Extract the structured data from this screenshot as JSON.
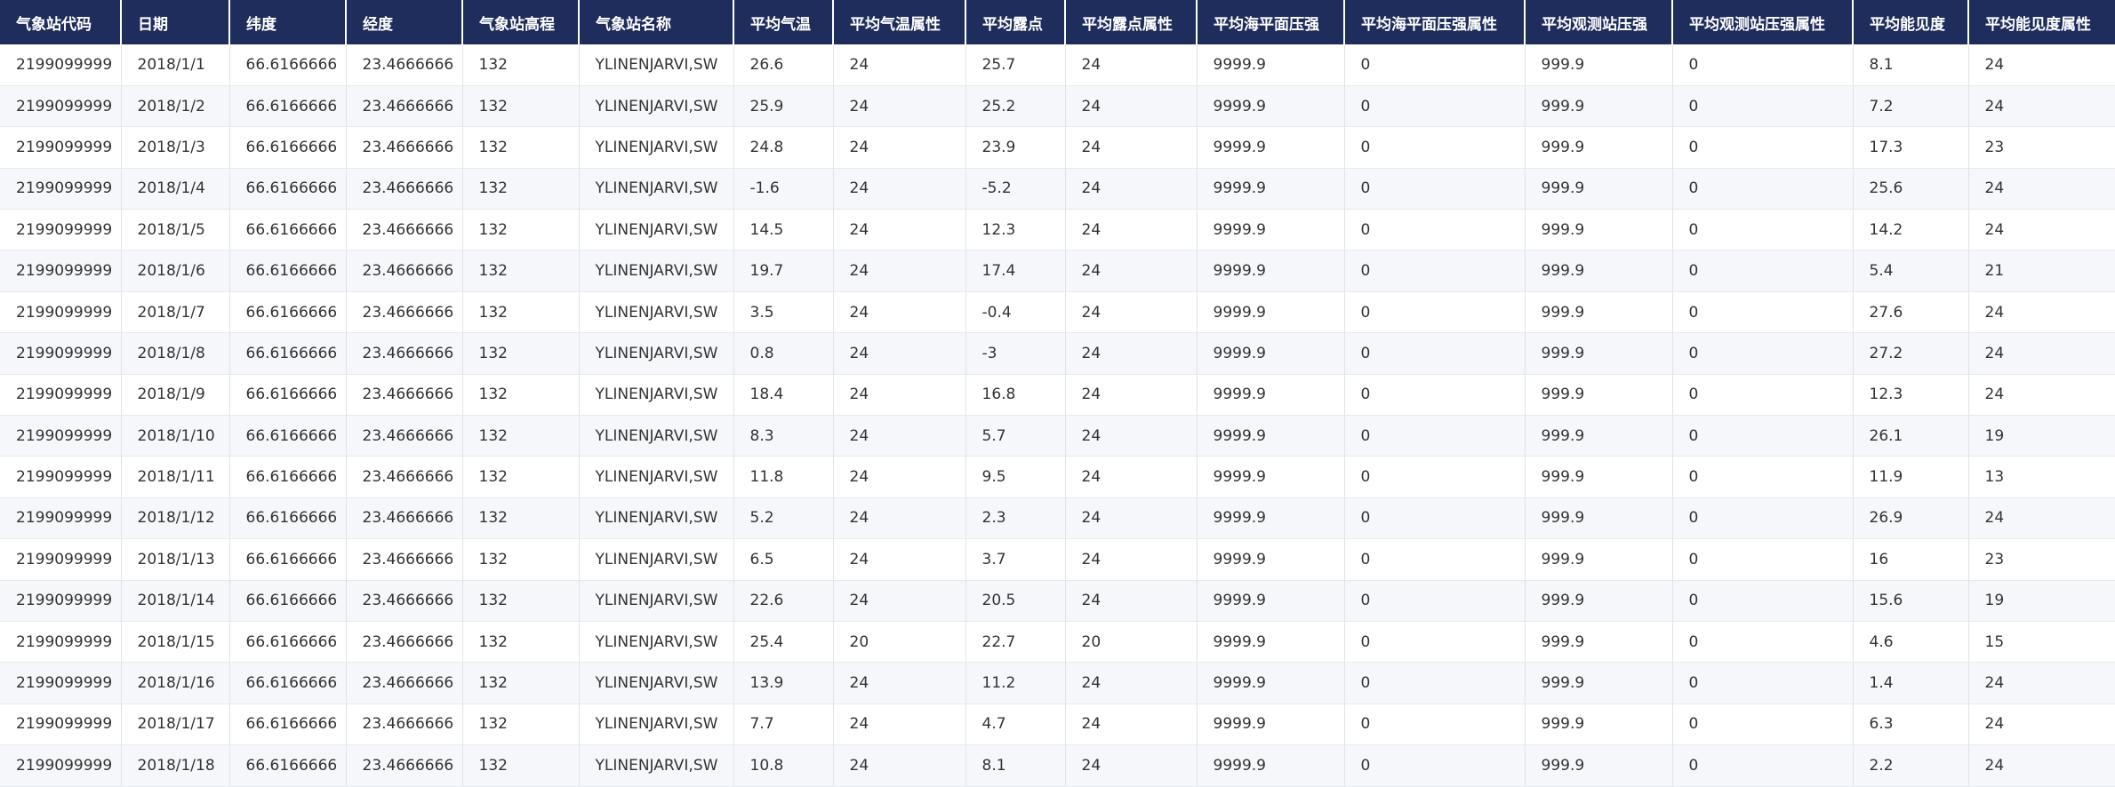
{
  "table": {
    "columns": [
      "气象站代码",
      "日期",
      "纬度",
      "经度",
      "气象站高程",
      "气象站名称",
      "平均气温",
      "平均气温属性",
      "平均露点",
      "平均露点属性",
      "平均海平面压强",
      "平均海平面压强属性",
      "平均观测站压强",
      "平均观测站压强属性",
      "平均能见度",
      "平均能见度属性"
    ],
    "rows": [
      [
        "2199099999",
        "2018/1/1",
        "66.6166666",
        "23.4666666",
        "132",
        "YLINENJARVI,SW",
        "26.6",
        "24",
        "25.7",
        "24",
        "9999.9",
        "0",
        "999.9",
        "0",
        "8.1",
        "24"
      ],
      [
        "2199099999",
        "2018/1/2",
        "66.6166666",
        "23.4666666",
        "132",
        "YLINENJARVI,SW",
        "25.9",
        "24",
        "25.2",
        "24",
        "9999.9",
        "0",
        "999.9",
        "0",
        "7.2",
        "24"
      ],
      [
        "2199099999",
        "2018/1/3",
        "66.6166666",
        "23.4666666",
        "132",
        "YLINENJARVI,SW",
        "24.8",
        "24",
        "23.9",
        "24",
        "9999.9",
        "0",
        "999.9",
        "0",
        "17.3",
        "23"
      ],
      [
        "2199099999",
        "2018/1/4",
        "66.6166666",
        "23.4666666",
        "132",
        "YLINENJARVI,SW",
        "-1.6",
        "24",
        "-5.2",
        "24",
        "9999.9",
        "0",
        "999.9",
        "0",
        "25.6",
        "24"
      ],
      [
        "2199099999",
        "2018/1/5",
        "66.6166666",
        "23.4666666",
        "132",
        "YLINENJARVI,SW",
        "14.5",
        "24",
        "12.3",
        "24",
        "9999.9",
        "0",
        "999.9",
        "0",
        "14.2",
        "24"
      ],
      [
        "2199099999",
        "2018/1/6",
        "66.6166666",
        "23.4666666",
        "132",
        "YLINENJARVI,SW",
        "19.7",
        "24",
        "17.4",
        "24",
        "9999.9",
        "0",
        "999.9",
        "0",
        "5.4",
        "21"
      ],
      [
        "2199099999",
        "2018/1/7",
        "66.6166666",
        "23.4666666",
        "132",
        "YLINENJARVI,SW",
        "3.5",
        "24",
        "-0.4",
        "24",
        "9999.9",
        "0",
        "999.9",
        "0",
        "27.6",
        "24"
      ],
      [
        "2199099999",
        "2018/1/8",
        "66.6166666",
        "23.4666666",
        "132",
        "YLINENJARVI,SW",
        "0.8",
        "24",
        "-3",
        "24",
        "9999.9",
        "0",
        "999.9",
        "0",
        "27.2",
        "24"
      ],
      [
        "2199099999",
        "2018/1/9",
        "66.6166666",
        "23.4666666",
        "132",
        "YLINENJARVI,SW",
        "18.4",
        "24",
        "16.8",
        "24",
        "9999.9",
        "0",
        "999.9",
        "0",
        "12.3",
        "24"
      ],
      [
        "2199099999",
        "2018/1/10",
        "66.6166666",
        "23.4666666",
        "132",
        "YLINENJARVI,SW",
        "8.3",
        "24",
        "5.7",
        "24",
        "9999.9",
        "0",
        "999.9",
        "0",
        "26.1",
        "19"
      ],
      [
        "2199099999",
        "2018/1/11",
        "66.6166666",
        "23.4666666",
        "132",
        "YLINENJARVI,SW",
        "11.8",
        "24",
        "9.5",
        "24",
        "9999.9",
        "0",
        "999.9",
        "0",
        "11.9",
        "13"
      ],
      [
        "2199099999",
        "2018/1/12",
        "66.6166666",
        "23.4666666",
        "132",
        "YLINENJARVI,SW",
        "5.2",
        "24",
        "2.3",
        "24",
        "9999.9",
        "0",
        "999.9",
        "0",
        "26.9",
        "24"
      ],
      [
        "2199099999",
        "2018/1/13",
        "66.6166666",
        "23.4666666",
        "132",
        "YLINENJARVI,SW",
        "6.5",
        "24",
        "3.7",
        "24",
        "9999.9",
        "0",
        "999.9",
        "0",
        "16",
        "23"
      ],
      [
        "2199099999",
        "2018/1/14",
        "66.6166666",
        "23.4666666",
        "132",
        "YLINENJARVI,SW",
        "22.6",
        "24",
        "20.5",
        "24",
        "9999.9",
        "0",
        "999.9",
        "0",
        "15.6",
        "19"
      ],
      [
        "2199099999",
        "2018/1/15",
        "66.6166666",
        "23.4666666",
        "132",
        "YLINENJARVI,SW",
        "25.4",
        "20",
        "22.7",
        "20",
        "9999.9",
        "0",
        "999.9",
        "0",
        "4.6",
        "15"
      ],
      [
        "2199099999",
        "2018/1/16",
        "66.6166666",
        "23.4666666",
        "132",
        "YLINENJARVI,SW",
        "13.9",
        "24",
        "11.2",
        "24",
        "9999.9",
        "0",
        "999.9",
        "0",
        "1.4",
        "24"
      ],
      [
        "2199099999",
        "2018/1/17",
        "66.6166666",
        "23.4666666",
        "132",
        "YLINENJARVI,SW",
        "7.7",
        "24",
        "4.7",
        "24",
        "9999.9",
        "0",
        "999.9",
        "0",
        "6.3",
        "24"
      ],
      [
        "2199099999",
        "2018/1/18",
        "66.6166666",
        "23.4666666",
        "132",
        "YLINENJARVI,SW",
        "10.8",
        "24",
        "8.1",
        "24",
        "9999.9",
        "0",
        "999.9",
        "0",
        "2.2",
        "24"
      ]
    ]
  }
}
